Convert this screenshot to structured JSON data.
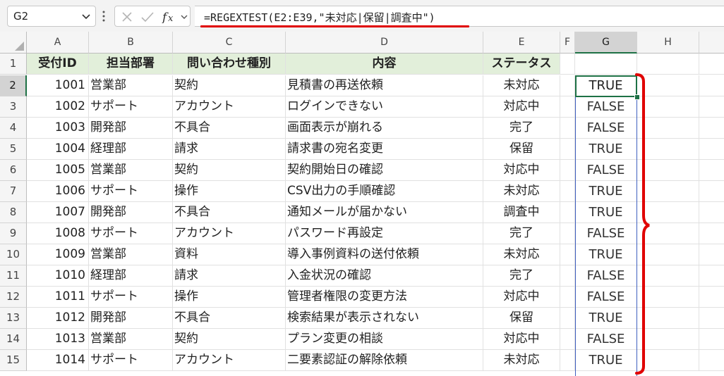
{
  "namebox": {
    "value": "G2"
  },
  "formula": {
    "text": "=REGEXTEST(E2:E39,\"未対応|保留|調査中\")"
  },
  "columns": [
    "A",
    "B",
    "C",
    "D",
    "E",
    "F",
    "G",
    "H"
  ],
  "header": [
    "受付ID",
    "担当部署",
    "問い合わせ種別",
    "内容",
    "ステータス"
  ],
  "rows": [
    {
      "num": "2",
      "id": "1001",
      "dept": "営業部",
      "type": "契約",
      "content": "見積書の再送依頼",
      "status": "未対応",
      "result": "TRUE"
    },
    {
      "num": "3",
      "id": "1002",
      "dept": "サポート",
      "type": "アカウント",
      "content": "ログインできない",
      "status": "対応中",
      "result": "FALSE"
    },
    {
      "num": "4",
      "id": "1003",
      "dept": "開発部",
      "type": "不具合",
      "content": "画面表示が崩れる",
      "status": "完了",
      "result": "FALSE"
    },
    {
      "num": "5",
      "id": "1004",
      "dept": "経理部",
      "type": "請求",
      "content": "請求書の宛名変更",
      "status": "保留",
      "result": "TRUE"
    },
    {
      "num": "6",
      "id": "1005",
      "dept": "営業部",
      "type": "契約",
      "content": "契約開始日の確認",
      "status": "対応中",
      "result": "FALSE"
    },
    {
      "num": "7",
      "id": "1006",
      "dept": "サポート",
      "type": "操作",
      "content": "CSV出力の手順確認",
      "status": "未対応",
      "result": "TRUE"
    },
    {
      "num": "8",
      "id": "1007",
      "dept": "開発部",
      "type": "不具合",
      "content": "通知メールが届かない",
      "status": "調査中",
      "result": "TRUE"
    },
    {
      "num": "9",
      "id": "1008",
      "dept": "サポート",
      "type": "アカウント",
      "content": "パスワード再設定",
      "status": "完了",
      "result": "FALSE"
    },
    {
      "num": "10",
      "id": "1009",
      "dept": "営業部",
      "type": "資料",
      "content": "導入事例資料の送付依頼",
      "status": "未対応",
      "result": "TRUE"
    },
    {
      "num": "11",
      "id": "1010",
      "dept": "経理部",
      "type": "請求",
      "content": "入金状況の確認",
      "status": "完了",
      "result": "FALSE"
    },
    {
      "num": "12",
      "id": "1011",
      "dept": "サポート",
      "type": "操作",
      "content": "管理者権限の変更方法",
      "status": "対応中",
      "result": "FALSE"
    },
    {
      "num": "13",
      "id": "1012",
      "dept": "開発部",
      "type": "不具合",
      "content": "検索結果が表示されない",
      "status": "保留",
      "result": "TRUE"
    },
    {
      "num": "14",
      "id": "1013",
      "dept": "営業部",
      "type": "契約",
      "content": "プラン変更の相談",
      "status": "対応中",
      "result": "FALSE"
    },
    {
      "num": "15",
      "id": "1014",
      "dept": "サポート",
      "type": "アカウント",
      "content": "二要素認証の解除依頼",
      "status": "未対応",
      "result": "TRUE"
    }
  ],
  "colors": {
    "header_fill": "#e2efda",
    "selection": "#1e7145",
    "annotation": "#e00000",
    "spill_border": "#3f5fbf"
  },
  "icons": [
    "chevron-down-icon",
    "more-options-icon",
    "cancel-icon",
    "enter-icon",
    "function-icon"
  ]
}
